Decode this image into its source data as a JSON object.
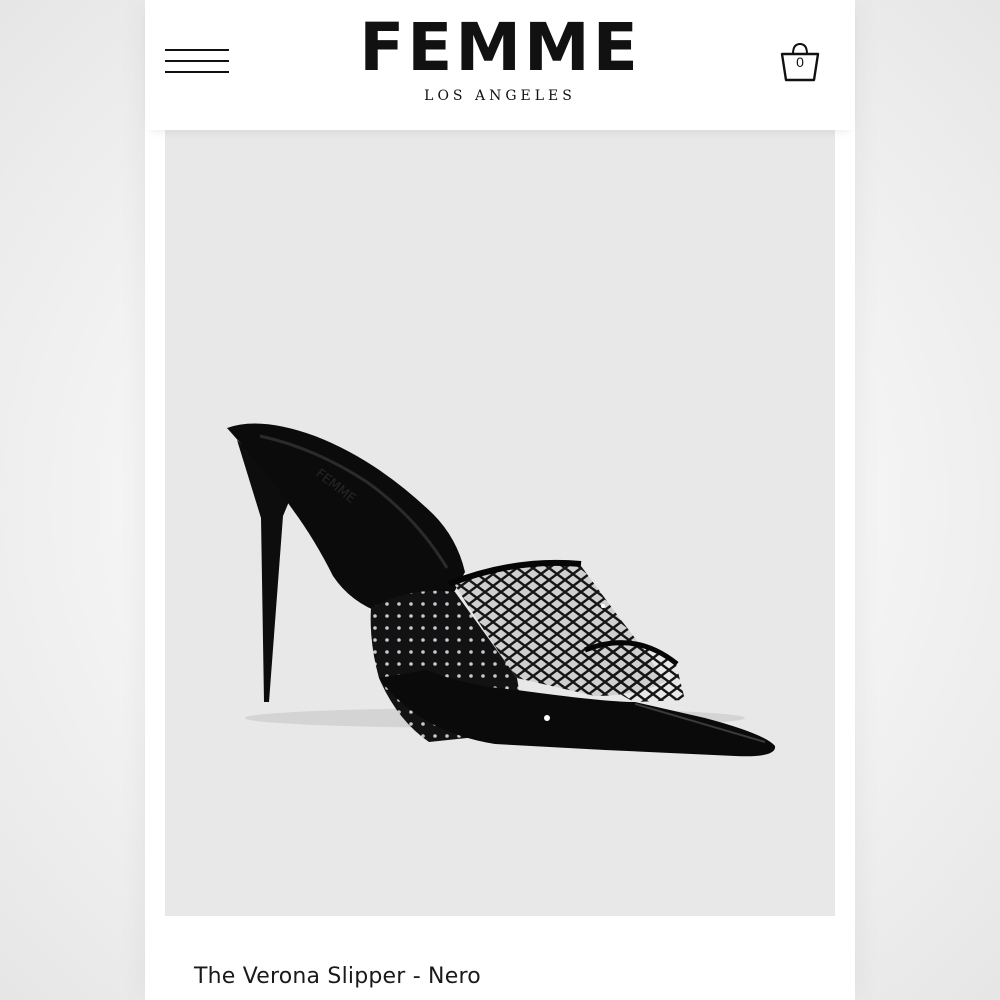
{
  "header": {
    "menu_icon": "hamburger-menu-icon",
    "brand_name": "FEMME",
    "brand_location": "LOS ANGELES",
    "cart_icon": "shopping-bag-icon",
    "cart_count": "0"
  },
  "product": {
    "image_subject": "black mesh stiletto mule with rhinestones",
    "title": "The Verona Slipper - Nero"
  },
  "colors": {
    "image_background": "#e8e8e8",
    "text": "#111111"
  }
}
